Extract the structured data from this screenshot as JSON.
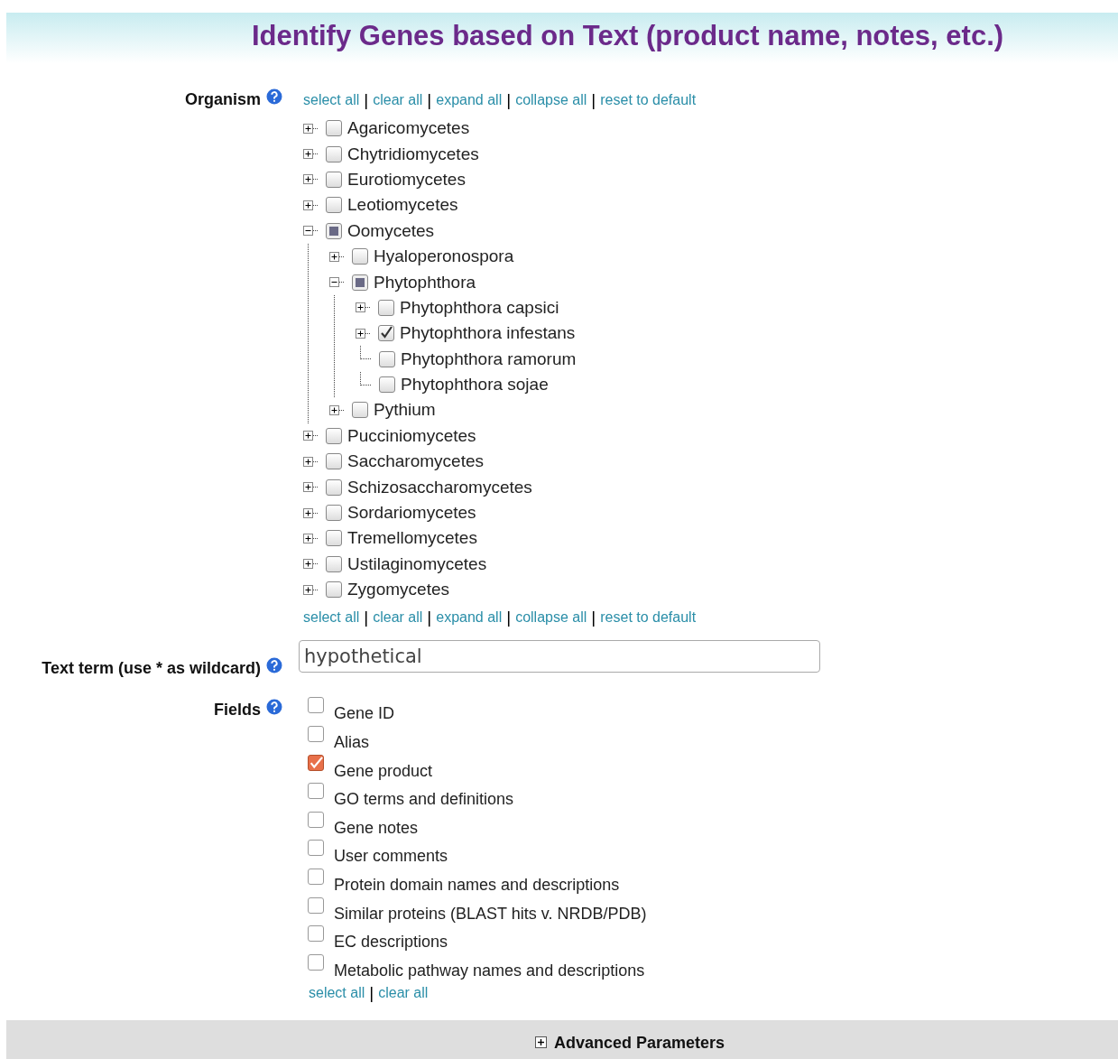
{
  "title": "Identify Genes based on Text (product name, notes, etc.)",
  "organism": {
    "label": "Organism",
    "separator": "|",
    "links_top": [
      "select all",
      "clear all",
      "expand all",
      "collapse all",
      "reset to default"
    ],
    "tree": [
      {
        "kind": "branch",
        "label": "Agaricomycetes",
        "checked": false,
        "partial": false,
        "expanded": false
      },
      {
        "kind": "branch",
        "label": "Chytridiomycetes",
        "checked": false,
        "partial": false,
        "expanded": false
      },
      {
        "kind": "branch",
        "label": "Eurotiomycetes",
        "checked": false,
        "partial": false,
        "expanded": false
      },
      {
        "kind": "branch",
        "label": "Leotiomycetes",
        "checked": false,
        "partial": false,
        "expanded": false
      },
      {
        "kind": "branch",
        "label": "Oomycetes",
        "checked": false,
        "partial": true,
        "expanded": true,
        "children": [
          {
            "kind": "branch",
            "label": "Hyaloperonospora",
            "checked": false,
            "partial": false,
            "expanded": false
          },
          {
            "kind": "branch",
            "label": "Phytophthora",
            "checked": false,
            "partial": true,
            "expanded": true,
            "children": [
              {
                "kind": "branch",
                "label": "Phytophthora capsici",
                "checked": false,
                "partial": false,
                "expanded": false
              },
              {
                "kind": "branch",
                "label": "Phytophthora infestans",
                "checked": true,
                "partial": false,
                "expanded": false
              },
              {
                "kind": "leaf",
                "label": "Phytophthora ramorum",
                "checked": false,
                "partial": false
              },
              {
                "kind": "leaf",
                "label": "Phytophthora sojae",
                "checked": false,
                "partial": false
              }
            ]
          },
          {
            "kind": "branch",
            "label": "Pythium",
            "checked": false,
            "partial": false,
            "expanded": false
          }
        ]
      },
      {
        "kind": "branch",
        "label": "Pucciniomycetes",
        "checked": false,
        "partial": false,
        "expanded": false
      },
      {
        "kind": "branch",
        "label": "Saccharomycetes",
        "checked": false,
        "partial": false,
        "expanded": false
      },
      {
        "kind": "branch",
        "label": "Schizosaccharomycetes",
        "checked": false,
        "partial": false,
        "expanded": false
      },
      {
        "kind": "branch",
        "label": "Sordariomycetes",
        "checked": false,
        "partial": false,
        "expanded": false
      },
      {
        "kind": "branch",
        "label": "Tremellomycetes",
        "checked": false,
        "partial": false,
        "expanded": false
      },
      {
        "kind": "branch",
        "label": "Ustilaginomycetes",
        "checked": false,
        "partial": false,
        "expanded": false
      },
      {
        "kind": "branch",
        "label": "Zygomycetes",
        "checked": false,
        "partial": false,
        "expanded": false
      }
    ],
    "links_bottom": [
      "select all",
      "clear all",
      "expand all",
      "collapse all",
      "reset to default"
    ]
  },
  "text_term": {
    "label": "Text term (use * as wildcard)",
    "value": "hypothetical"
  },
  "fields": {
    "label": "Fields",
    "separator": "|",
    "options": [
      {
        "label": "Gene ID",
        "checked": false
      },
      {
        "label": "Alias",
        "checked": false
      },
      {
        "label": "Gene product",
        "checked": true
      },
      {
        "label": "GO terms and definitions",
        "checked": false
      },
      {
        "label": "Gene notes",
        "checked": false
      },
      {
        "label": "User comments",
        "checked": false
      },
      {
        "label": "Protein domain names and descriptions",
        "checked": false
      },
      {
        "label": "Similar proteins (BLAST hits v. NRDB/PDB)",
        "checked": false
      },
      {
        "label": "EC descriptions",
        "checked": false
      },
      {
        "label": "Metabolic pathway names and descriptions",
        "checked": false
      }
    ],
    "links": [
      "select all",
      "clear all"
    ]
  },
  "advanced": {
    "label": "Advanced Parameters",
    "expanded": false
  }
}
